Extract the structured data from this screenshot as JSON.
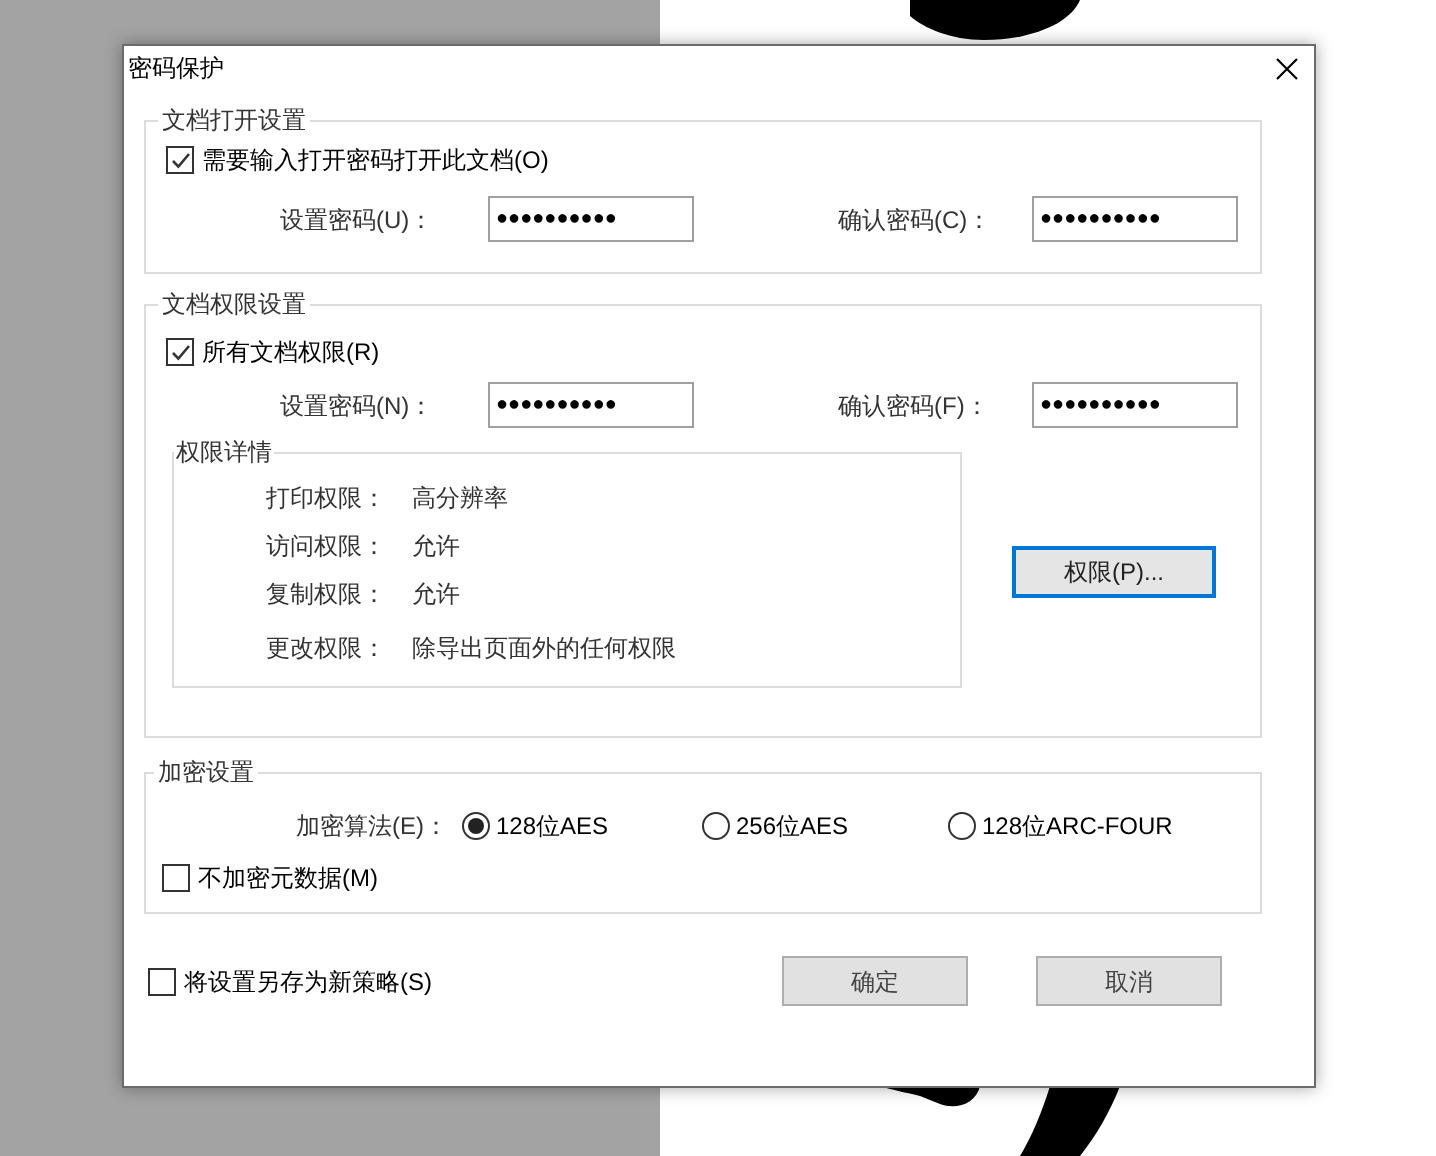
{
  "window": {
    "title": "密码保护"
  },
  "open_settings": {
    "title": "文档打开设置",
    "checkbox": {
      "label": "需要输入打开密码打开此文档(O)",
      "checked": true
    },
    "fields": [
      {
        "label": "设置密码(U)：",
        "value": "●●●●●●●●●●"
      },
      {
        "label": "确认密码(C)：",
        "value": "●●●●●●●●●●"
      }
    ]
  },
  "permission_settings": {
    "title": "文档权限设置",
    "checkbox": {
      "label": "所有文档权限(R)",
      "checked": true
    },
    "fields": [
      {
        "label": "设置密码(N)：",
        "value": "●●●●●●●●●●"
      },
      {
        "label": "确认密码(F)：",
        "value": "●●●●●●●●●●"
      }
    ],
    "details": {
      "title": "权限详情",
      "rows": [
        {
          "label": "打印权限：",
          "value": "高分辨率"
        },
        {
          "label": "访问权限：",
          "value": "允许"
        },
        {
          "label": "复制权限：",
          "value": "允许"
        },
        {
          "label": "更改权限：",
          "value": "除导出页面外的任何权限"
        }
      ]
    },
    "button": "权限(P)..."
  },
  "encryption": {
    "title": "加密设置",
    "label": "加密算法(E)：",
    "options": [
      {
        "label": "128位AES",
        "selected": true
      },
      {
        "label": "256位AES",
        "selected": false
      },
      {
        "label": "128位ARC-FOUR",
        "selected": false
      }
    ],
    "checkbox": {
      "label": "不加密元数据(M)",
      "checked": false
    }
  },
  "footer": {
    "checkbox": {
      "label": "将设置另存为新策略(S)",
      "checked": false
    },
    "buttons": [
      "确定",
      "取消"
    ]
  }
}
